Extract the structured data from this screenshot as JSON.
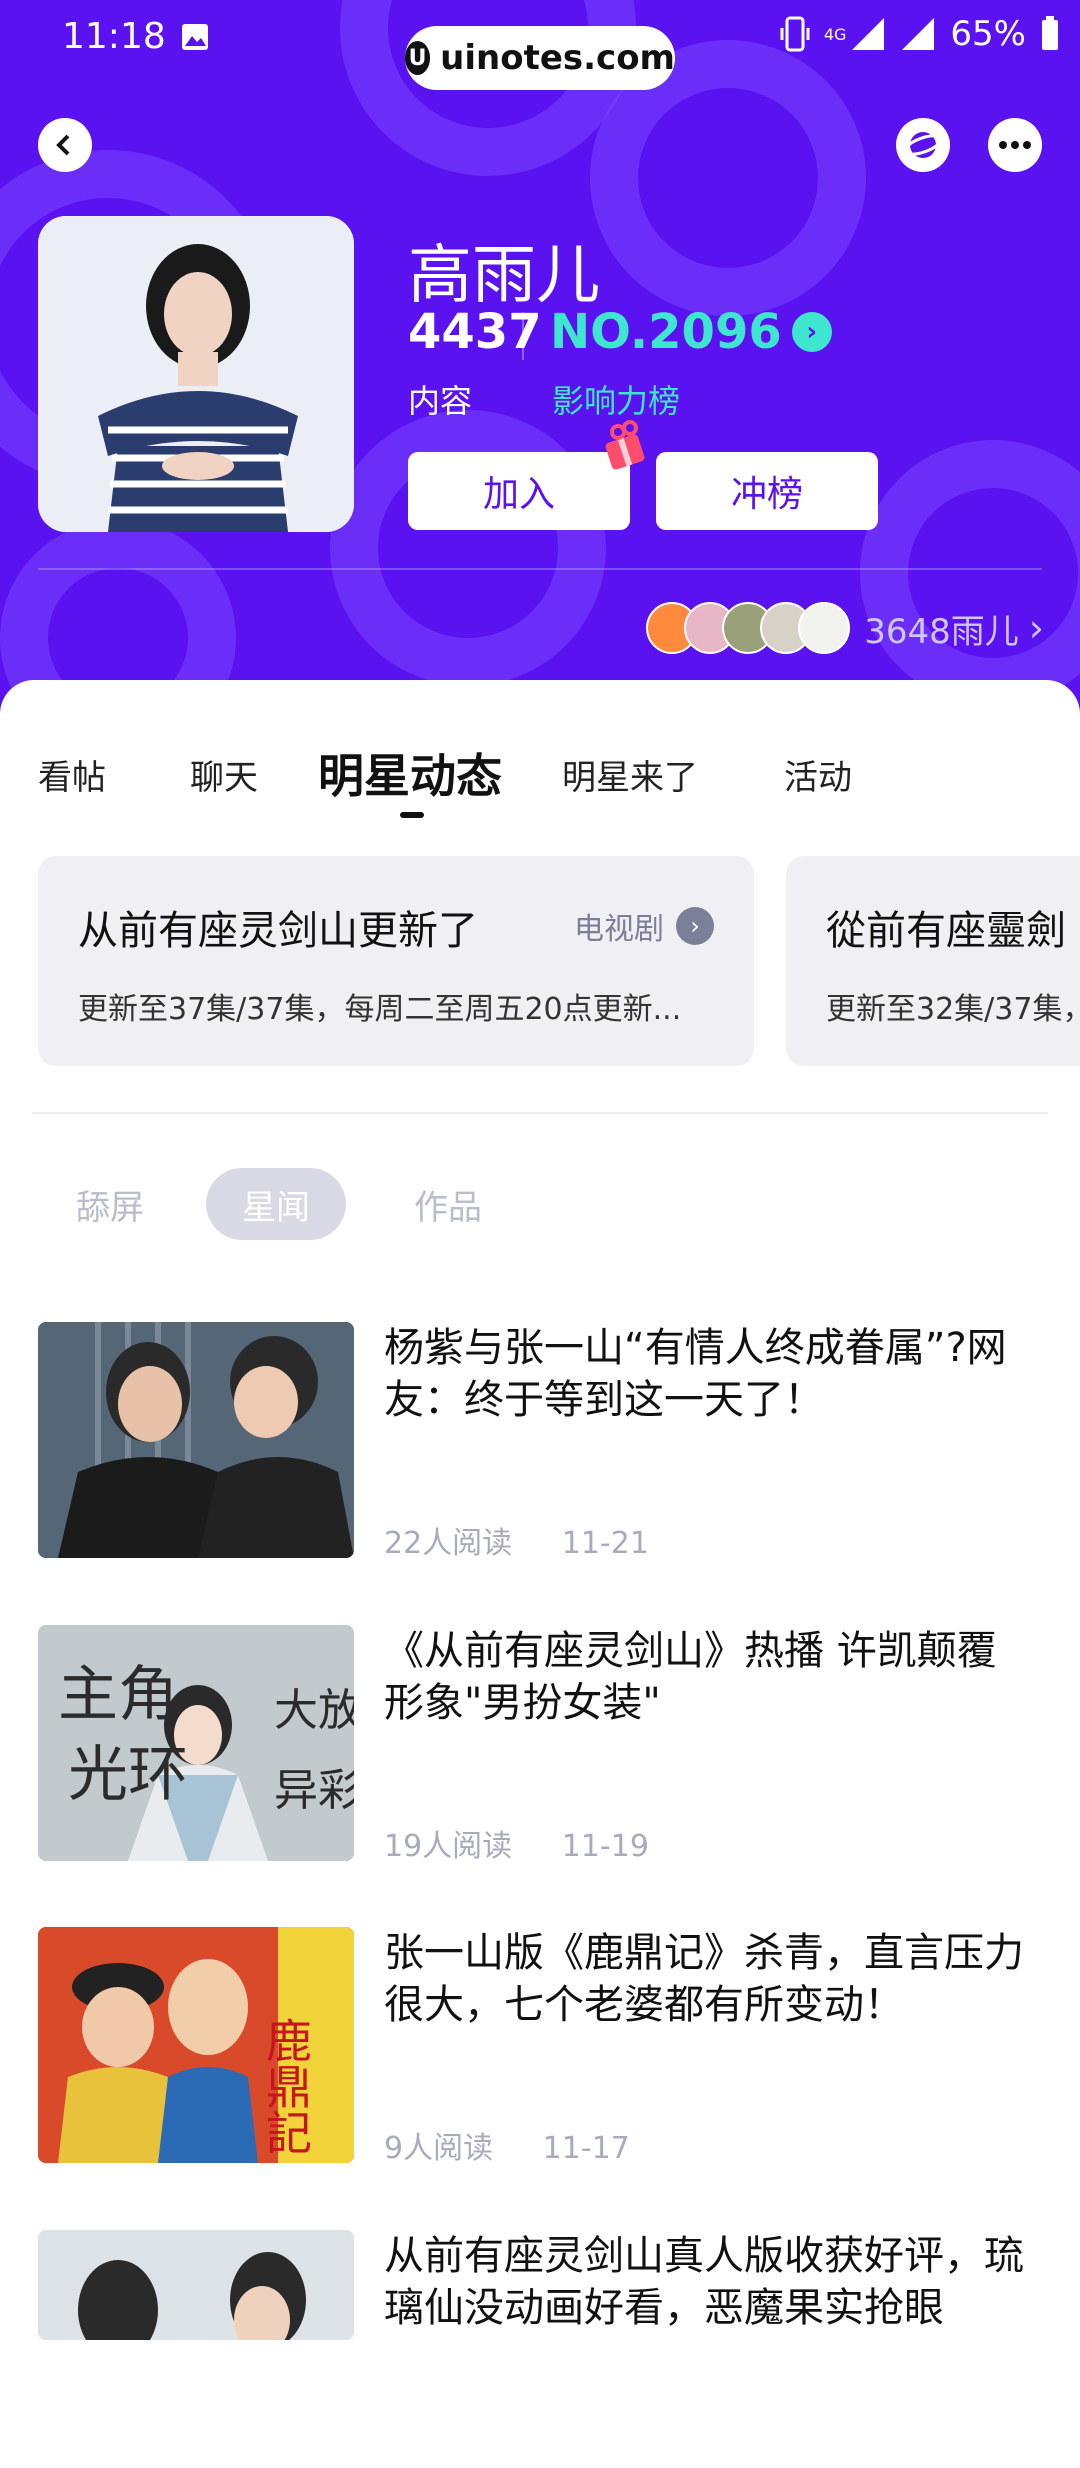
{
  "status": {
    "time": "11:18",
    "watermark": "uinotes.com",
    "network": "4G",
    "battery": "65%"
  },
  "profile": {
    "name": "高雨儿",
    "content_count": "4437",
    "content_label": "内容",
    "rank": "NO.2096",
    "rank_label": "影响力榜",
    "join_label": "加入",
    "boost_label": "冲榜",
    "fans_count": "3648雨儿"
  },
  "tabs": [
    {
      "label": "看帖",
      "active": false
    },
    {
      "label": "聊天",
      "active": false
    },
    {
      "label": "明星动态",
      "active": true
    },
    {
      "label": "明星来了",
      "active": false
    },
    {
      "label": "活动",
      "active": false
    }
  ],
  "cards": [
    {
      "title": "从前有座灵剑山更新了",
      "tag": "电视剧",
      "desc": "更新至37集/37集，每周二至周五20点更新..."
    },
    {
      "title": "從前有座靈劍",
      "desc": "更新至32集/37集，"
    }
  ],
  "subtabs": [
    {
      "label": "舔屏",
      "active": false
    },
    {
      "label": "星闻",
      "active": true
    },
    {
      "label": "作品",
      "active": false
    }
  ],
  "news": [
    {
      "title": "杨紫与张一山“有情人终成眷属”?网友：终于等到这一天了！",
      "reads": "22人阅读",
      "date": "11-21"
    },
    {
      "title": "《从前有座灵剑山》热播 许凯颠覆形象\"男扮女装\"",
      "reads": "19人阅读",
      "date": "11-19"
    },
    {
      "title": "张一山版《鹿鼎记》杀青，直言压力很大，七个老婆都有所变动！",
      "reads": "9人阅读",
      "date": "11-17"
    },
    {
      "title": "从前有座灵剑山真人版收获好评，琉璃仙没动画好看，恶魔果实抢眼",
      "reads": "",
      "date": ""
    }
  ],
  "thumb_texts": {
    "news2": [
      "主角",
      "光环",
      "大放",
      "异彩"
    ],
    "news3": [
      "鹿鼎記"
    ]
  },
  "colors": {
    "brand": "#5a12f0",
    "accent": "#3ee6d0"
  }
}
